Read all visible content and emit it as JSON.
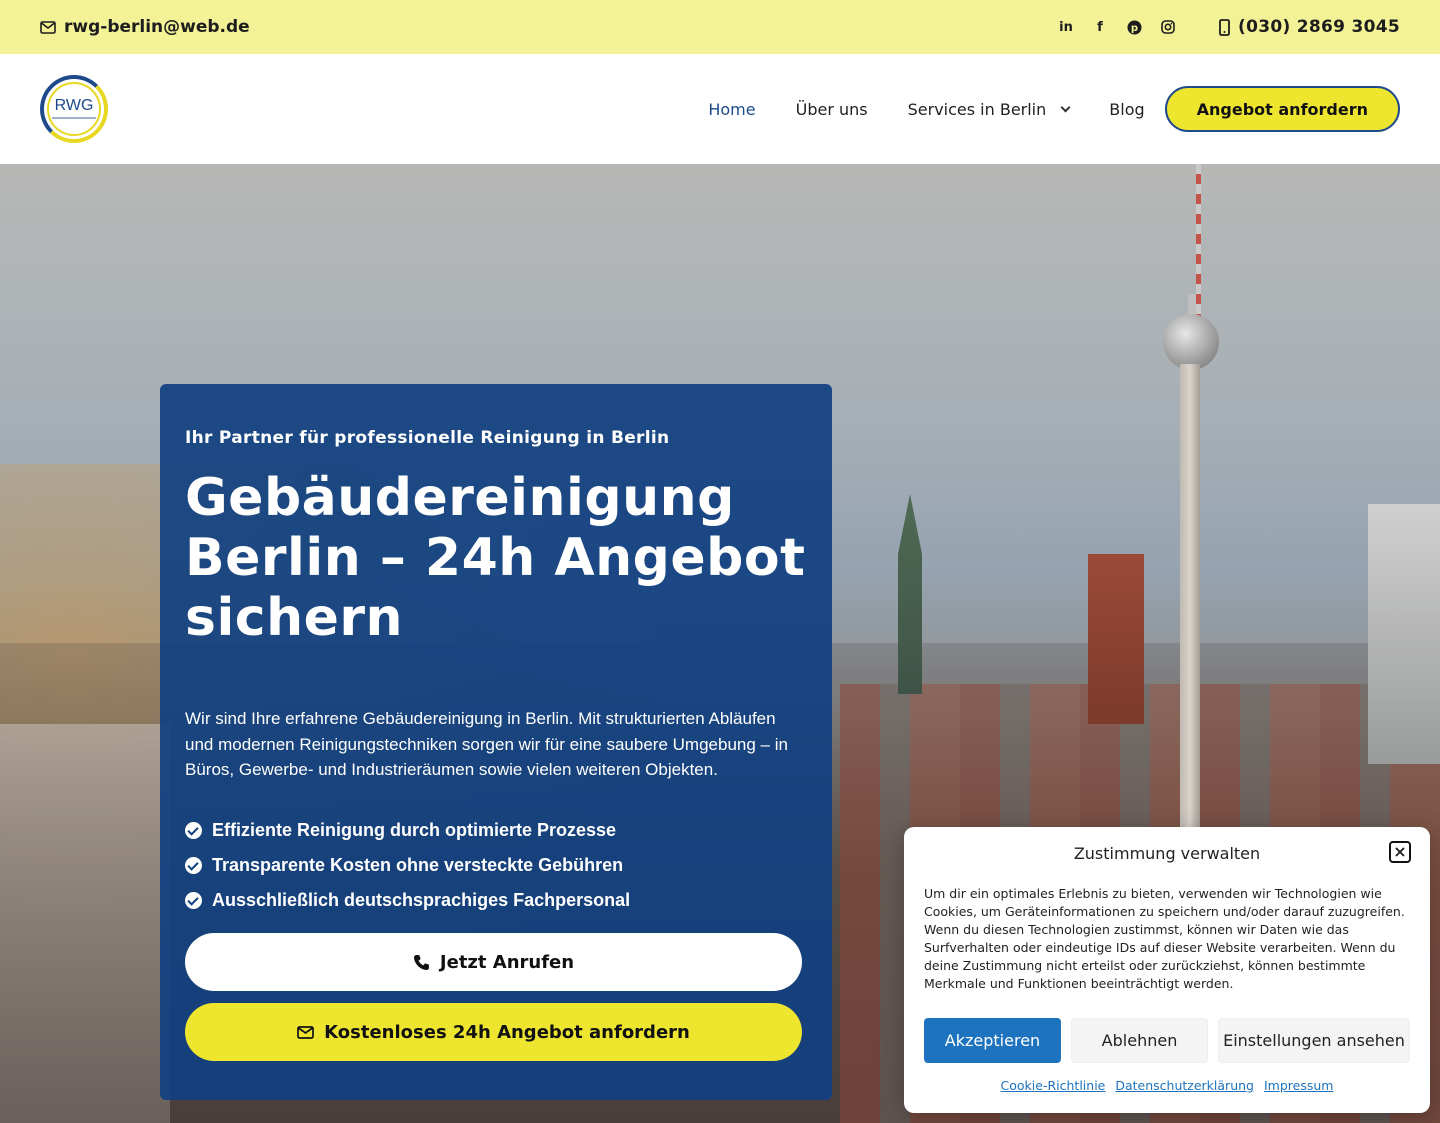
{
  "topbar": {
    "email": "rwg-berlin@web.de",
    "phone": "(030) 2869 3045",
    "social": [
      "linkedin-icon",
      "facebook-icon",
      "pinterest-icon",
      "instagram-icon"
    ]
  },
  "header": {
    "logo_text": "RWG",
    "nav": [
      {
        "label": "Home",
        "active": true
      },
      {
        "label": "Über uns"
      },
      {
        "label": "Services in Berlin",
        "has_dropdown": true
      },
      {
        "label": "Blog"
      }
    ],
    "cta": "Angebot anfordern"
  },
  "hero": {
    "kicker": "Ihr Partner für professionelle Reinigung in Berlin",
    "headline": "Gebäudereinigung Berlin – 24h Angebot sichern",
    "lead": "Wir sind Ihre erfahrene Gebäudereinigung in Berlin. Mit strukturierten Abläufen und modernen Reinigungstechniken sorgen wir für eine saubere Umgebung – in Büros, Gewerbe- und Industrieräumen sowie vielen weiteren Objekten.",
    "bullets": [
      "Effiziente Reinigung durch optimierte Prozesse",
      "Transparente Kosten ohne versteckte Gebühren",
      "Ausschließlich deutschsprachiges Fachpersonal"
    ],
    "call_button": "Jetzt Anrufen",
    "offer_button": "Kostenloses 24h Angebot anfordern"
  },
  "cookie": {
    "title": "Zustimmung verwalten",
    "text": "Um dir ein optimales Erlebnis zu bieten, verwenden wir Technologien wie Cookies, um Geräteinformationen zu speichern und/oder darauf zuzugreifen. Wenn du diesen Technologien zustimmst, können wir Daten wie das Surfverhalten oder eindeutige IDs auf dieser Website verarbeiten. Wenn du deine Zustimmung nicht erteilst oder zurückziehst, können bestimmte Merkmale und Funktionen beeinträchtigt werden.",
    "accept": "Akzeptieren",
    "decline": "Ablehnen",
    "settings": "Einstellungen ansehen",
    "links": [
      "Cookie-Richtlinie",
      "Datenschutzerklärung",
      "Impressum"
    ]
  },
  "colors": {
    "topbar_bg": "#f3f297",
    "brand_blue": "#104080",
    "accent_yellow": "#eee52e",
    "cookie_primary": "#1e73be"
  }
}
